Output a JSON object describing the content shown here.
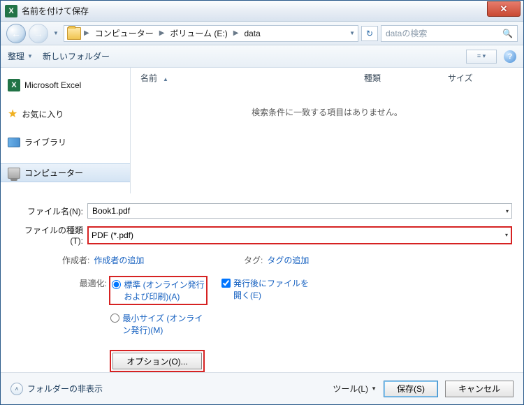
{
  "title": "名前を付けて保存",
  "breadcrumb": {
    "root": "コンピューター",
    "vol": "ボリューム (E:)",
    "folder": "data"
  },
  "search": {
    "placeholder": "dataの検索"
  },
  "toolbar": {
    "organize": "整理",
    "newfolder": "新しいフォルダー"
  },
  "sidebar": {
    "excel": "Microsoft Excel",
    "fav": "お気に入り",
    "lib": "ライブラリ",
    "comp": "コンピューター"
  },
  "cols": {
    "name": "名前",
    "type": "種類",
    "size": "サイズ"
  },
  "empty": "検索条件に一致する項目はありません。",
  "filename": {
    "label": "ファイル名(N):",
    "value": "Book1.pdf"
  },
  "filetype": {
    "label": "ファイルの種類(T):",
    "value": "PDF (*.pdf)"
  },
  "meta": {
    "author_k": "作成者:",
    "author_v": "作成者の追加",
    "tag_k": "タグ:",
    "tag_v": "タグの追加"
  },
  "optimize": {
    "label": "最適化:",
    "standard": "標準 (オンライン発行\nおよび印刷)(A)",
    "min": "最小サイズ (オンライ\nン発行)(M)",
    "openafter": "発行後にファイルを\n開く(E)",
    "options_btn": "オプション(O)..."
  },
  "footer": {
    "hide": "フォルダーの非表示",
    "tools": "ツール(L)",
    "save": "保存(S)",
    "cancel": "キャンセル"
  }
}
